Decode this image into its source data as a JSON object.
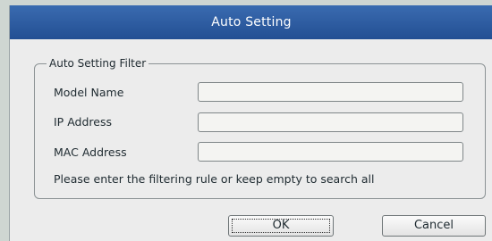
{
  "dialog": {
    "title": "Auto Setting"
  },
  "filter": {
    "legend": "Auto Setting Filter",
    "fields": [
      {
        "label": "Model Name",
        "value": ""
      },
      {
        "label": "IP Address",
        "value": ""
      },
      {
        "label": "MAC Address",
        "value": ""
      }
    ],
    "hint": "Please enter the filtering rule or keep empty to search all"
  },
  "buttons": {
    "ok": "OK",
    "cancel": "Cancel"
  },
  "colors": {
    "titlebar": "#2a5aa0",
    "background": "#ececec"
  }
}
